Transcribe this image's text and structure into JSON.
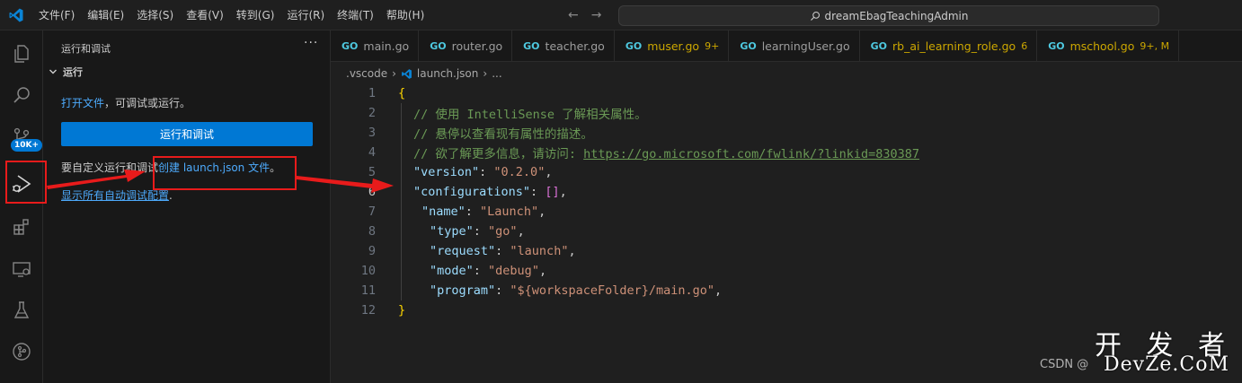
{
  "titlebar": {
    "menu": [
      "文件(F)",
      "编辑(E)",
      "选择(S)",
      "查看(V)",
      "转到(G)",
      "运行(R)",
      "终端(T)",
      "帮助(H)"
    ],
    "search_text": "dreamEbagTeachingAdmin"
  },
  "activity": {
    "badge": "10K+"
  },
  "sidebar": {
    "title": "运行和调试",
    "more": "···",
    "section": "运行",
    "open_file_link": "打开文件",
    "open_file_rest": "，可调试或运行。",
    "run_button": "运行和调试",
    "custom_text": "要自定义运行和调试",
    "create_link": "创建 launch.json 文件",
    "create_suffix": "。",
    "show_all_link": "显示所有自动调试配置",
    "show_all_suffix": "."
  },
  "tabs": [
    {
      "label": "main.go",
      "status": "",
      "warn": false
    },
    {
      "label": "router.go",
      "status": "",
      "warn": false
    },
    {
      "label": "teacher.go",
      "status": "",
      "warn": false
    },
    {
      "label": "muser.go",
      "status": "9+",
      "warn": true
    },
    {
      "label": "learningUser.go",
      "status": "",
      "warn": false
    },
    {
      "label": "rb_ai_learning_role.go",
      "status": "6",
      "warn": true
    },
    {
      "label": "mschool.go",
      "status": "9+, M",
      "warn": true
    }
  ],
  "breadcrumb": {
    "folder": ".vscode",
    "file": "launch.json",
    "tail": "..."
  },
  "code": {
    "line_numbers": [
      "1",
      "2",
      "3",
      "4",
      "5",
      "6",
      "7",
      "8",
      "9",
      "10",
      "11",
      "12"
    ],
    "active_line": 6,
    "l1": "{",
    "l2": "// 使用 IntelliSense 了解相关属性。",
    "l3": "// 悬停以查看现有属性的描述。",
    "l4_text": "// 欲了解更多信息，请访问: ",
    "l4_url": "https://go.microsoft.com/fwlink/?linkid=830387",
    "l5_key": "\"version\"",
    "l5_val": "\"0.2.0\"",
    "l6_key": "\"configurations\"",
    "l6_val": "[]",
    "l7_key": "\"name\"",
    "l7_val": "\"Launch\"",
    "l8_key": "\"type\"",
    "l8_val": "\"go\"",
    "l9_key": "\"request\"",
    "l9_val": "\"launch\"",
    "l10_key": "\"mode\"",
    "l10_val": "\"debug\"",
    "l11_key": "\"program\"",
    "l11_val": "\"${workspaceFolder}/main.go\"",
    "l12": "}"
  },
  "watermark": {
    "csdn": "CSDN @",
    "cn": "开 发 者",
    "en": "DevZe.CoM"
  },
  "colors": {
    "accent": "#0078d4",
    "annotation": "#e81b1b",
    "link": "#4daafc"
  }
}
